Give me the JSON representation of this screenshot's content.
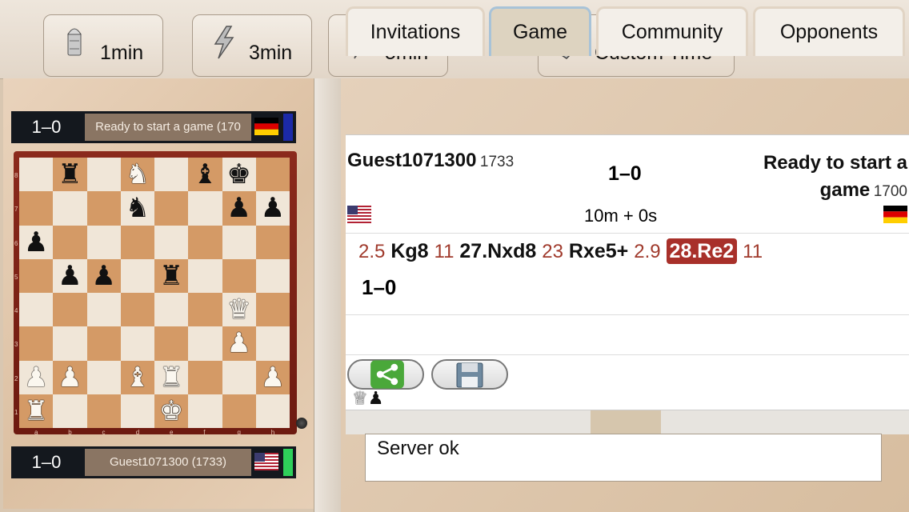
{
  "toolbar": {
    "buttons": [
      {
        "label": "1min",
        "icon": "bullet-icon"
      },
      {
        "label": "3min",
        "icon": "lightning-icon"
      },
      {
        "label": "5min",
        "icon": "lightning-icon"
      },
      {
        "label": "Custom Time",
        "icon": "wrench-icon"
      }
    ]
  },
  "top_player": {
    "score": "1–0",
    "name": "Ready to start a game (170",
    "flag": "germany-flag-icon"
  },
  "bottom_player": {
    "score": "1–0",
    "name": "Guest1071300 (1733)",
    "flag": "usa-flag-icon"
  },
  "board": {
    "ranks": [
      "8",
      "7",
      "6",
      "5",
      "4",
      "3",
      "2",
      "1"
    ],
    "files": [
      "a",
      "b",
      "c",
      "d",
      "e",
      "f",
      "g",
      "h"
    ],
    "rows": [
      [
        "",
        "bR",
        "",
        "wN",
        "",
        "bB",
        "bK",
        ""
      ],
      [
        "",
        "",
        "",
        "bN",
        "",
        "",
        "bP",
        "bP"
      ],
      [
        "bP",
        "",
        "",
        "",
        "",
        "",
        "",
        ""
      ],
      [
        "",
        "bP",
        "bP",
        "",
        "bR",
        "",
        "",
        ""
      ],
      [
        "",
        "",
        "",
        "",
        "",
        "",
        "wQ",
        ""
      ],
      [
        "",
        "",
        "",
        "",
        "",
        "",
        "wP",
        ""
      ],
      [
        "wP",
        "wP",
        "",
        "wB",
        "wR",
        "",
        "",
        "wP"
      ],
      [
        "wR",
        "",
        "",
        "",
        "wK",
        "",
        "",
        ""
      ]
    ]
  },
  "tabs": [
    {
      "label": "Invitations"
    },
    {
      "label": "Game",
      "active": true
    },
    {
      "label": "Community"
    },
    {
      "label": "Opponents"
    }
  ],
  "game": {
    "white_name": "Guest1071300",
    "white_rating": "1733",
    "result": "1–0",
    "black_name_line1": "Ready to start a",
    "black_name_line2": "game",
    "black_rating": "1700",
    "time_control": "10m + 0s",
    "moves": [
      {
        "time": "2.5",
        "move": "Kg8"
      },
      {
        "time": "11",
        "move": "27.Nxd8"
      },
      {
        "time": "23",
        "move": "Rxe5+"
      },
      {
        "time": "2.9",
        "move": "28.Re2",
        "current": true
      },
      {
        "time": "11",
        "move": ""
      }
    ],
    "final_result": "1–0"
  },
  "status": {
    "message": "Server ok"
  },
  "colors": {
    "accent_highlight": "#a8302a",
    "move_time": "#a03a2c",
    "board_dark": "#d49a66",
    "board_light": "#f0e6d8"
  }
}
